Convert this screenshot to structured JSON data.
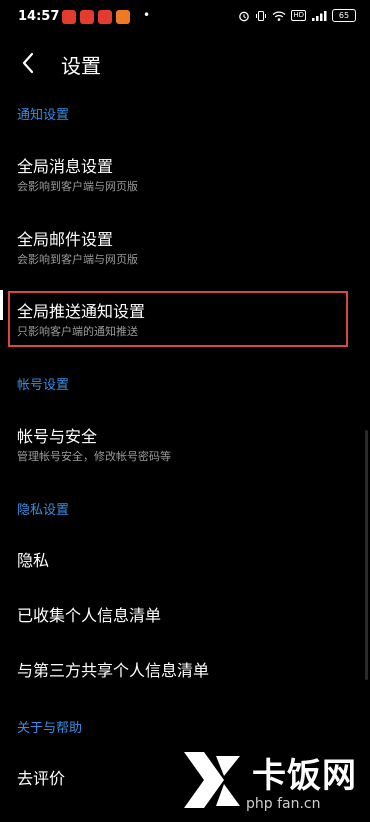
{
  "status_bar": {
    "time": "14:57",
    "dot": "•",
    "network_badge": "HD",
    "battery": "65",
    "app_icons": [
      {
        "name": "app-icon-1",
        "color": "#e33b2e"
      },
      {
        "name": "app-icon-2",
        "color": "#e33b2e"
      },
      {
        "name": "app-icon-3",
        "color": "#e33b2e"
      },
      {
        "name": "app-icon-4",
        "color": "#f07a23"
      }
    ]
  },
  "header": {
    "title": "设置"
  },
  "sections": {
    "notify": "通知设置",
    "account": "帐号设置",
    "privacy": "隐私设置",
    "about": "关于与帮助"
  },
  "items": {
    "global_message": {
      "title": "全局消息设置",
      "subtitle": "会影响到客户端与网页版"
    },
    "global_mail": {
      "title": "全局邮件设置",
      "subtitle": "会影响到客户端与网页版"
    },
    "global_push": {
      "title": "全局推送通知设置",
      "subtitle": "只影响客户端的通知推送"
    },
    "account_security": {
      "title": "帐号与安全",
      "subtitle": "管理帐号安全，修改帐号密码等"
    },
    "privacy": {
      "title": "隐私"
    },
    "collected_info": {
      "title": "已收集个人信息清单"
    },
    "third_party": {
      "title": "与第三方共享个人信息清单"
    },
    "rate": {
      "title": "去评价"
    }
  },
  "watermark": {
    "name": "卡饭网",
    "url": "php fan.cn"
  },
  "colors": {
    "accent": "#3a8ce0",
    "highlight": "#d8483f",
    "background": "#000000"
  }
}
